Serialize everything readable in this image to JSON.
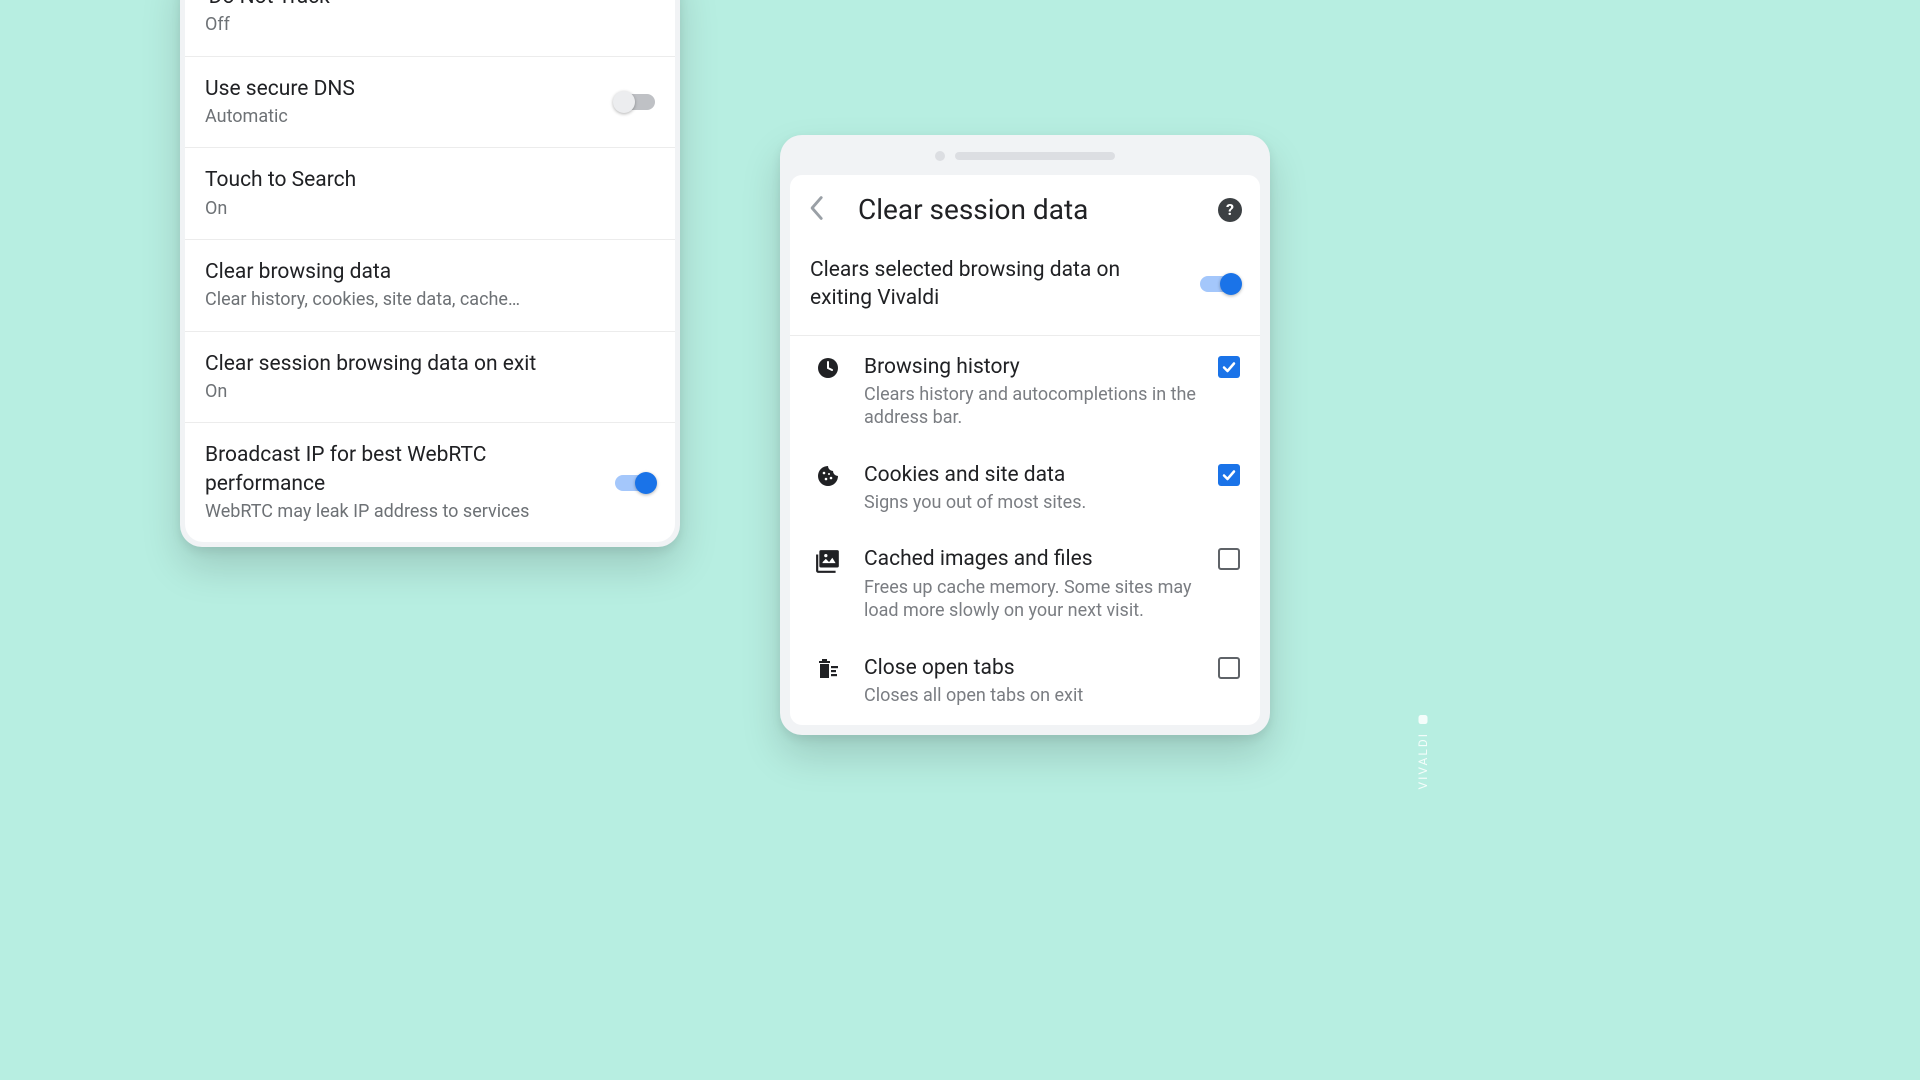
{
  "leftPanel": {
    "items": [
      {
        "title": "'Do Not Track'",
        "subtitle": "Off",
        "control": "none"
      },
      {
        "title": "Use secure DNS",
        "subtitle": "Automatic",
        "control": "toggle",
        "on": false
      },
      {
        "title": "Touch to Search",
        "subtitle": "On",
        "control": "none"
      },
      {
        "title": "Clear browsing data",
        "subtitle": "Clear history, cookies, site data, cache…",
        "control": "none"
      },
      {
        "title": "Clear session browsing data on exit",
        "subtitle": "On",
        "control": "none"
      },
      {
        "title": "Broadcast IP for best WebRTC performance",
        "subtitle": "WebRTC may leak IP address to services",
        "control": "toggle",
        "on": true
      }
    ]
  },
  "rightPanel": {
    "header_title": "Clear session data",
    "master_label": "Clears selected browsing data on exiting Vivaldi",
    "master_on": true,
    "options": [
      {
        "icon": "history-icon",
        "title": "Browsing history",
        "subtitle": "Clears history and autocompletions in the address bar.",
        "checked": true
      },
      {
        "icon": "cookie-icon",
        "title": "Cookies and site data",
        "subtitle": "Signs you out of most sites.",
        "checked": true
      },
      {
        "icon": "image-icon",
        "title": "Cached images and files",
        "subtitle": "Frees up cache memory. Some sites may load more slowly on your next visit.",
        "checked": false
      },
      {
        "icon": "delete-icon",
        "title": "Close open tabs",
        "subtitle": "Closes all open tabs on exit",
        "checked": false
      }
    ]
  },
  "watermark": "VIVALDI"
}
